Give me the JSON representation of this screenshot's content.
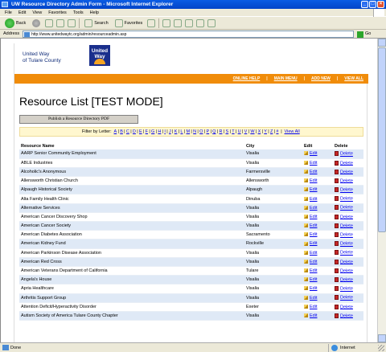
{
  "window": {
    "title": "UW Resource Directory Admin Form - Microsoft Internet Explorer"
  },
  "menu": [
    "File",
    "Edit",
    "View",
    "Favorites",
    "Tools",
    "Help"
  ],
  "toolbar": {
    "back": "Back",
    "search": "Search",
    "favorites": "Favorites"
  },
  "address": {
    "label": "Address",
    "url": "http://www.unitedwaytc.org/admin/resourceadmin.asp",
    "go": "Go"
  },
  "logo": {
    "line1": "United Way",
    "line2": "of Tulare County",
    "box1": "United",
    "box2": "Way"
  },
  "nav": [
    "ONLINE HELP",
    "MAIN MENU",
    "ADD NEW",
    "VIEW ALL"
  ],
  "page_title": "Resource List [TEST MODE]",
  "publish_button": "Publish a Resource Directory PDF",
  "filter": {
    "label": "Filter by Letter:",
    "letters": [
      "A",
      "B",
      "C",
      "D",
      "E",
      "F",
      "G",
      "H",
      "I",
      "J",
      "K",
      "L",
      "M",
      "N",
      "O",
      "P",
      "Q",
      "R",
      "S",
      "T",
      "U",
      "V",
      "W",
      "X",
      "Y",
      "Z",
      "#"
    ],
    "view_all": "View All"
  },
  "table": {
    "headers": {
      "name": "Resource Name",
      "city": "City",
      "edit": "Edit",
      "delete": "Delete"
    },
    "edit_label": "Edit",
    "delete_label": "Delete",
    "rows": [
      {
        "name": "AARP Senior Community Employment",
        "city": "Visalia"
      },
      {
        "name": "ABLE Industries",
        "city": "Visalia"
      },
      {
        "name": "Alcoholic's Anonymous",
        "city": "Farmersville"
      },
      {
        "name": "Allensworth Christian Church",
        "city": "Allensworth"
      },
      {
        "name": "Alpaugh Historical Society",
        "city": "Alpaugh"
      },
      {
        "name": "Alta Family Health Clinic",
        "city": "Dinuba"
      },
      {
        "name": "Alternative Services",
        "city": "Visalia"
      },
      {
        "name": "American Cancer Discovery Shop",
        "city": "Visalia"
      },
      {
        "name": "American Cancer Society",
        "city": "Visalia"
      },
      {
        "name": "American Diabetes Association",
        "city": "Sacramento"
      },
      {
        "name": "American Kidney Fund",
        "city": "Rockville"
      },
      {
        "name": "American Parkinson Disease Association",
        "city": "Visalia"
      },
      {
        "name": "American Red Cross",
        "city": "Visalia"
      },
      {
        "name": "American Veterans Department of California",
        "city": "Tulare"
      },
      {
        "name": "Angela's House",
        "city": "Visalia"
      },
      {
        "name": "Apria Healthcare",
        "city": "Visalia"
      },
      {
        "name": "Arthritis Support Group",
        "city": "Visalia"
      },
      {
        "name": "Attention Deficit/Hyperactivity Disorder",
        "city": "Exeter"
      },
      {
        "name": "Autism Society of America Tulare County Chapter",
        "city": "Visalia"
      }
    ]
  },
  "status": {
    "left": "Done",
    "zone": "Internet"
  }
}
